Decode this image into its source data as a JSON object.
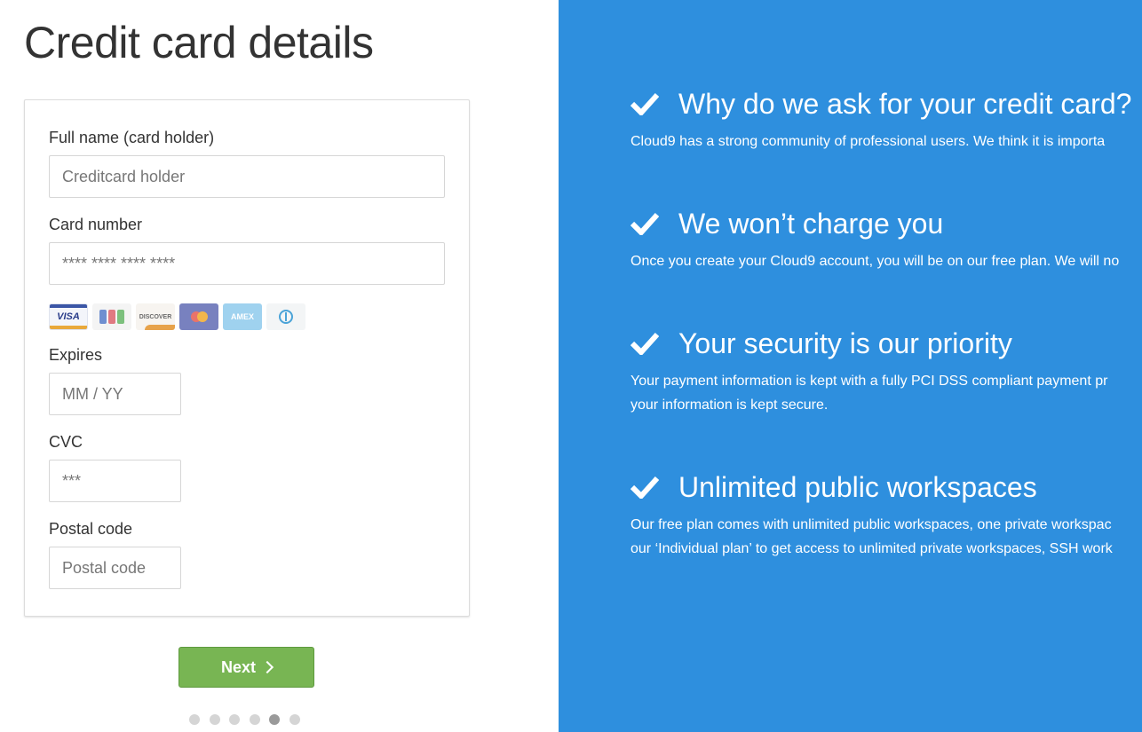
{
  "page_title": "Credit card details",
  "form": {
    "card_holder": {
      "label": "Full name (card holder)",
      "placeholder": "Creditcard holder"
    },
    "card_number": {
      "label": "Card number",
      "placeholder": "**** **** **** ****"
    },
    "card_brands": [
      "VISA",
      "JCB",
      "DISCOVER",
      "MasterCard",
      "AMEX",
      "Diners Club"
    ],
    "expires": {
      "label": "Expires",
      "placeholder": "MM / YY"
    },
    "cvc": {
      "label": "CVC",
      "placeholder": "***"
    },
    "postal_code": {
      "label": "Postal code",
      "placeholder": "Postal code"
    }
  },
  "next_button": {
    "label": "Next"
  },
  "steps": {
    "total": 6,
    "current": 5
  },
  "reasons": [
    {
      "title": "Why do we ask for your credit card?",
      "text": "Cloud9 has a strong community of professional users. We think it is importa"
    },
    {
      "title": "We won’t charge you",
      "text": "Once you create your Cloud9 account, you will be on our free plan. We will no"
    },
    {
      "title": "Your security is our priority",
      "text": "Your payment information is kept with a fully PCI DSS compliant payment pr\nyour information is kept secure."
    },
    {
      "title": "Unlimited public workspaces",
      "text": "Our free plan comes with unlimited public workspaces, one private workspac\nour ‘Individual plan’ to get access to unlimited private workspaces, SSH work"
    }
  ],
  "colors": {
    "accent_panel": "#2e8fde",
    "next_button": "#78b553"
  },
  "icons": {
    "reason_bullet": "checkmark-icon",
    "next_button": "chevron-right-icon"
  }
}
